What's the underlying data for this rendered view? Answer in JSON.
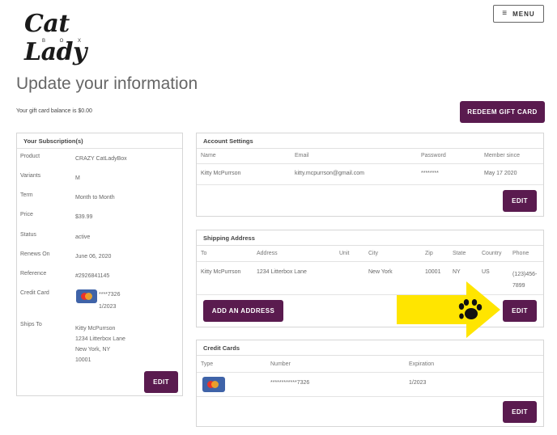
{
  "brand": {
    "logo_text": "Cat Lady",
    "logo_sub": "B O X"
  },
  "header": {
    "menu_label": "MENU",
    "menu_icon": "hamburger-icon"
  },
  "page": {
    "title": "Update your information",
    "balance_text": "Your gift card balance is $0.00",
    "redeem_label": "REDEEM GIFT CARD"
  },
  "subscription": {
    "title": "Your Subscription(s)",
    "rows": [
      {
        "label": "Product",
        "value": "CRAZY CatLadyBox"
      },
      {
        "label": "Variants",
        "value": "M"
      },
      {
        "label": "Term",
        "value": "Month to Month"
      },
      {
        "label": "Price",
        "value": "$39.99"
      },
      {
        "label": "Status",
        "value": "active"
      },
      {
        "label": "Renews On",
        "value": "June 06, 2020"
      },
      {
        "label": "Reference",
        "value": "#2926841145"
      }
    ],
    "credit_card_label": "Credit Card",
    "card_number": "****7326",
    "card_expiry": "1/2023",
    "ships_to_label": "Ships To",
    "ships_to_lines": [
      "Kitty McPurrson",
      "1234 Litterbox Lane",
      "New York, NY",
      "10001"
    ],
    "edit_label": "EDIT"
  },
  "account": {
    "title": "Account Settings",
    "headers": {
      "name": "Name",
      "email": "Email",
      "password": "Password",
      "member_since": "Member since"
    },
    "values": {
      "name": "Kitty McPurrson",
      "email": "kitty.mcpurrson@gmail.com",
      "password": "********",
      "member_since": "May 17 2020"
    },
    "edit_label": "EDIT"
  },
  "shipping": {
    "title": "Shipping Address",
    "headers": {
      "to": "To",
      "address": "Address",
      "unit": "Unit",
      "city": "City",
      "zip": "Zip",
      "state": "State",
      "country": "Country",
      "phone": "Phone"
    },
    "row": {
      "to": "Kitty McPurrson",
      "address": "1234 Litterbox Lane",
      "unit": "",
      "city": "New York",
      "zip": "10001",
      "state": "NY",
      "country": "US",
      "phone_line1": "(123)456-",
      "phone_line2": "7899"
    },
    "add_label": "ADD AN ADDRESS",
    "edit_label": "EDIT"
  },
  "cards": {
    "title": "Credit Cards",
    "headers": {
      "type": "Type",
      "number": "Number",
      "expiration": "Expiration"
    },
    "row": {
      "number": "************7326",
      "expiration": "1/2023"
    },
    "edit_label": "EDIT"
  },
  "colors": {
    "accent": "#5a1b4f",
    "arrow": "#ffe500",
    "card_blue": "#3f63a8"
  }
}
